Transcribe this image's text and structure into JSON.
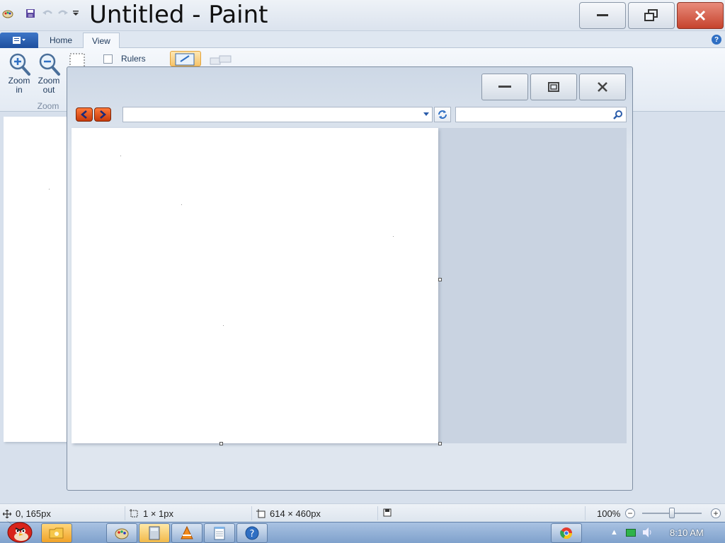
{
  "window": {
    "title": "Untitled - Paint"
  },
  "ribbon": {
    "tabs": [
      {
        "label": "Home"
      },
      {
        "label": "View"
      }
    ],
    "zoom_in_label": "Zoom in",
    "zoom_out_label": "Zoom out",
    "zoom_group_label": "Zoom",
    "rulers_label": "Rulers",
    "rulers_checked": false
  },
  "viewer": {
    "address_value": "",
    "search_value": ""
  },
  "status": {
    "cursor_position": "0, 165px",
    "selection_size": "1 × 1px",
    "image_size": "614 × 460px",
    "zoom_percent": "100%",
    "zoom_fraction": 0.5
  },
  "taskbar": {
    "clock": "8:10 AM",
    "apps": [
      "angry-birds-icon",
      "explorer-icon",
      "paint-icon",
      "calculator-icon",
      "vlc-icon",
      "notepad-icon",
      "help-icon"
    ]
  },
  "colors": {
    "accent": "#2f6fc3",
    "close": "#c6432d"
  }
}
